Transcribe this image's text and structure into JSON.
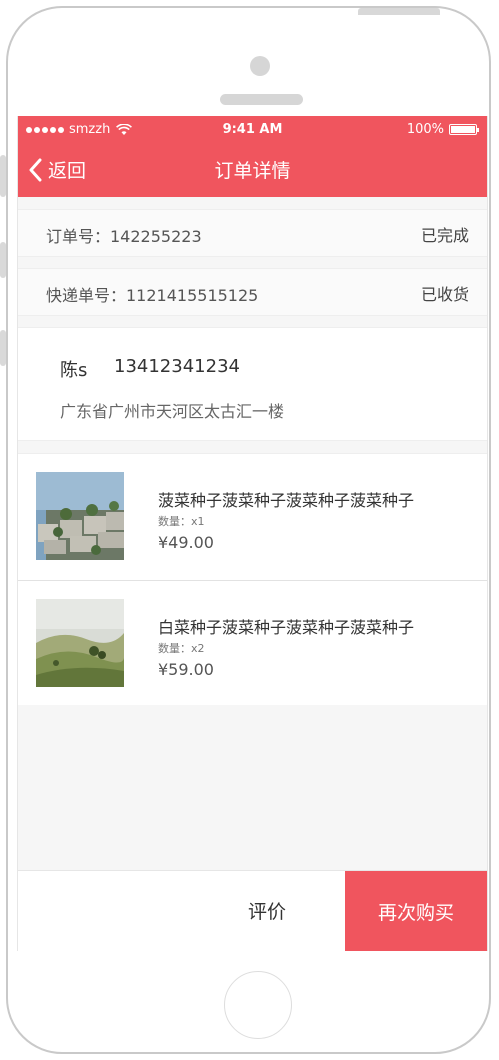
{
  "status_bar": {
    "carrier": "smzzh",
    "time": "9:41 AM",
    "battery": "100%"
  },
  "nav": {
    "back_label": "返回",
    "title": "订单详情"
  },
  "order": {
    "number_label": "订单号：142255223",
    "status": "已完成"
  },
  "shipping": {
    "tracking_label": "快递单号：1121415515125",
    "status": "已收货"
  },
  "address": {
    "name": "陈s",
    "phone": "13412341234",
    "detail": "广东省广州市天河区太古汇一楼"
  },
  "products": [
    {
      "name": "菠菜种子菠菜种子菠菜种子菠菜种子",
      "quantity": "数量：x1",
      "price": "¥49.00"
    },
    {
      "name": "白菜种子菠菜种子菠菜种子菠菜种子",
      "quantity": "数量：x2",
      "price": "¥59.00"
    }
  ],
  "actions": {
    "review": "评价",
    "rebuy": "再次购买"
  },
  "colors": {
    "accent": "#f0555e"
  }
}
